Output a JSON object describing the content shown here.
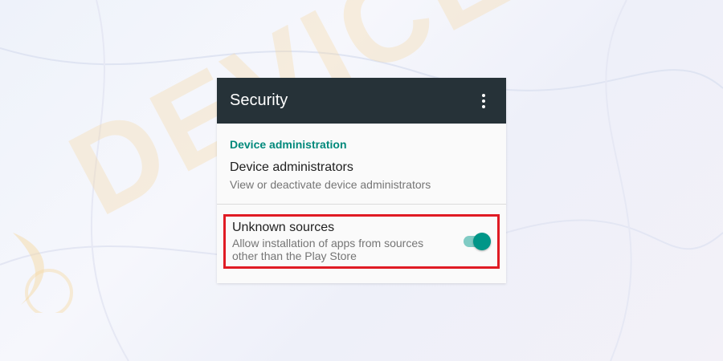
{
  "watermark": {
    "text": "DEVICETRICKS"
  },
  "toolbar": {
    "title": "Security",
    "menu_icon": "more-vert-icon"
  },
  "section": {
    "header": "Device administration"
  },
  "device_admins": {
    "title": "Device administrators",
    "summary": "View or deactivate device administrators"
  },
  "unknown_sources": {
    "title": "Unknown sources",
    "summary_line1": "Allow installation of apps from sources",
    "summary_line2": "other than the Play Store",
    "enabled": true
  },
  "colors": {
    "appbar": "#263238",
    "accent": "#00897b",
    "switch_thumb": "#009688",
    "switch_track": "#80cbc4",
    "highlight": "#e01b24"
  }
}
